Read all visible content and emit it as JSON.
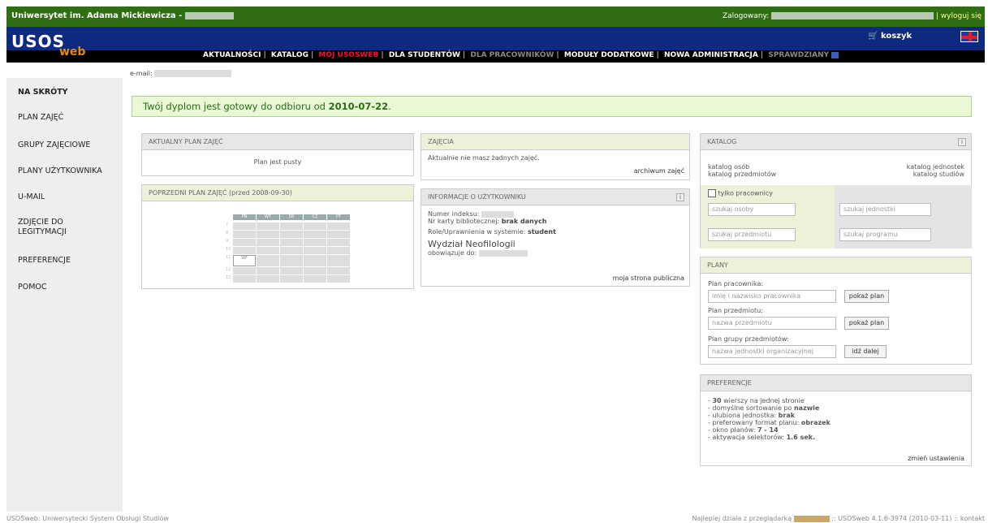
{
  "topbar": {
    "university": "Uniwersytet im. Adama Mickiewicza -",
    "logged_label": "Zalogowany:",
    "logout": "| wyloguj się"
  },
  "header": {
    "logo_main": "USOS",
    "logo_sub": "web",
    "cart": "koszyk"
  },
  "nav": {
    "items": [
      "AKTUALNOŚCI",
      "KATALOG",
      "MÓJ USOSWEB",
      "DLA STUDENTÓW",
      "DLA PRACOWNIKÓW",
      "MODUŁY DODATKOWE",
      "NOWA ADMINISTRACJA",
      "SPRAWDZIANY"
    ]
  },
  "email_label": "e-mail:",
  "sidebar": {
    "items": [
      "NA SKRÓTY",
      "PLAN ZAJĘĆ",
      "GRUPY ZAJĘCIOWE",
      "PLANY UŻYTKOWNIKA",
      "U-MAIL",
      "ZDJĘCIE DO",
      "LEGITYMACJI",
      "PREFERENCJE",
      "POMOC"
    ]
  },
  "notice": {
    "text": "Twój dyplom jest gotowy do odbioru od",
    "date": "2010-07-22",
    "dot": "."
  },
  "plan_current": {
    "title": "AKTUALNY PLAN ZAJĘĆ",
    "body": "Plan jest pusty"
  },
  "plan_prev": {
    "title": "POPRZEDNI PLAN ZAJĘĆ (przed 2008-09-30)",
    "days": [
      "PN",
      "WT",
      "ŚR",
      "CZ",
      "PT"
    ],
    "hours": [
      "7",
      "8",
      "9",
      "10",
      "11",
      "12",
      "13"
    ],
    "event_label": "WF"
  },
  "zajecia": {
    "title": "ZAJĘCIA",
    "body": "Aktualnie nie masz żadnych zajęć.",
    "link": "archiwum zajęć"
  },
  "user_info": {
    "title": "INFORMACJE O UŻYTKOWNIKU",
    "index_label": "Numer indeksu:",
    "card_label": "Nr karty bibliotecznej:",
    "card_value": "brak danych",
    "role_label": "Role/Uprawnienia w systemie:",
    "role_value": "student",
    "faculty": "Wydział Neofilologii",
    "valid_label": "obowiązuje do:",
    "link": "moja strona publiczna"
  },
  "catalog": {
    "title": "KATALOG",
    "links_left": [
      "katalog osób",
      "katalog przedmiotów"
    ],
    "links_right": [
      "katalog jednostek",
      "katalog studiów"
    ],
    "checkbox_label": "tylko pracownicy",
    "placeholders": [
      "szukaj osoby",
      "szukaj jednostki",
      "szukaj przedmiotu",
      "szukaj programu"
    ]
  },
  "plany": {
    "title": "PLANY",
    "worker_label": "Plan pracownika:",
    "worker_ph": "imię i nazwisko pracownika",
    "worker_btn": "pokaż plan",
    "subject_label": "Plan przedmiotu:",
    "subject_ph": "nazwa przedmiotu",
    "subject_btn": "pokaż plan",
    "group_label": "Plan grupy przedmiotów:",
    "group_ph": "nazwa jednostki organizacyjnej",
    "group_btn": "idź dalej"
  },
  "prefs": {
    "title": "PREFERENCJE",
    "l1a": "- ",
    "l1b": "30",
    "l1c": " wierszy na jednej stronie",
    "l2a": "- domyślne sortowanie po ",
    "l2b": "nazwie",
    "l3a": "- ulubiona jednostka: ",
    "l3b": "brak",
    "l4a": "- preferowany format planu: ",
    "l4b": "obrazek",
    "l5a": "- okno planów: ",
    "l5b": "7 - 14",
    "l6a": "- aktywacja selektorów: ",
    "l6b": "1.6 sek.",
    "link": "zmień ustawienia"
  },
  "footer": {
    "left": "USOSweb: Uniwersytecki System Obsługi Studiów",
    "right_a": "Najlepiej działa z przeglądarką",
    "right_b": ":: USOSweb 4.1.6-3974 (2010-03-11) :: kontakt"
  },
  "colors": {
    "topbar": "#2f6e12",
    "header": "#0d2a80",
    "accent": "#e13"
  }
}
